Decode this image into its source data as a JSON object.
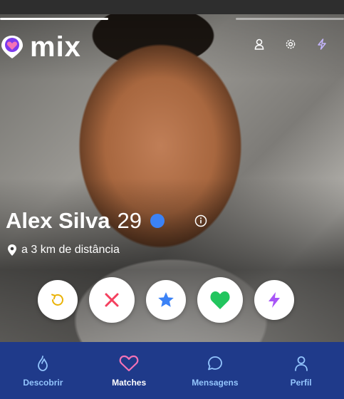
{
  "brand": {
    "name": "mix"
  },
  "profile": {
    "name": "Alex Silva",
    "age": "29",
    "distance": "a 3 km de distância"
  },
  "story_progress": {
    "segments": 3,
    "active_index": 0
  },
  "colors": {
    "nav_bg": "#1f3a8a",
    "nav_inactive": "#93c5fd",
    "nav_active": "#ffffff",
    "verified": "#3b82f6",
    "rewind": "#eab308",
    "nope": "#f43f5e",
    "superlike": "#3b82f6",
    "like": "#22c55e",
    "boost": "#a855f7",
    "accent_heart": "#f472b6"
  },
  "top_icons": [
    "user-icon",
    "settings-icon",
    "boost-icon"
  ],
  "actions": [
    "rewind-icon",
    "nope-icon",
    "star-icon",
    "heart-icon",
    "bolt-icon"
  ],
  "nav": {
    "tabs": [
      {
        "label": "Descobrir",
        "icon": "flame-icon"
      },
      {
        "label": "Matches",
        "icon": "heart-icon"
      },
      {
        "label": "Mensagens",
        "icon": "chat-icon"
      },
      {
        "label": "Perfil",
        "icon": "user-icon"
      }
    ],
    "active_tab": "Matches"
  }
}
